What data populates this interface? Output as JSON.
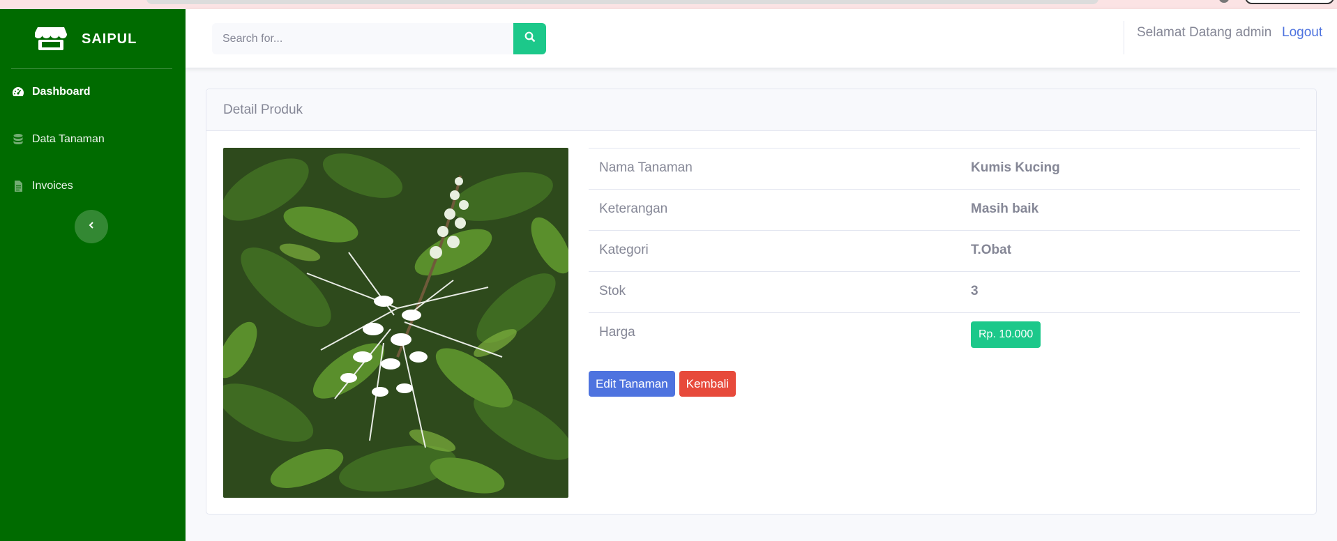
{
  "brand": {
    "name": "SAIPUL",
    "icon": "store-icon"
  },
  "sidebar": {
    "items": [
      {
        "label": "Dashboard",
        "icon": "tachometer-icon",
        "active": true
      },
      {
        "label": "Data Tanaman",
        "icon": "database-icon",
        "active": false
      },
      {
        "label": "Invoices",
        "icon": "file-icon",
        "active": false
      }
    ],
    "toggle_icon": "chevron-left-icon"
  },
  "topbar": {
    "search_placeholder": "Search for...",
    "search_icon": "search-icon",
    "welcome_text": "Selamat Datang admin",
    "logout_label": "Logout"
  },
  "card": {
    "title": "Detail Produk",
    "image_alt": "Kumis Kucing plant with white flowers",
    "details": [
      {
        "label": "Nama Tanaman",
        "value": "Kumis Kucing"
      },
      {
        "label": "Keterangan",
        "value": "Masih baik"
      },
      {
        "label": "Kategori",
        "value": "T.Obat"
      },
      {
        "label": "Stok",
        "value": "3"
      }
    ],
    "price": {
      "label": "Harga",
      "value": "Rp. 10.000"
    },
    "edit_label": "Edit Tanaman",
    "back_label": "Kembali"
  },
  "colors": {
    "sidebar": "#006b00",
    "accent_green": "#1cc88a",
    "primary": "#4e73df",
    "danger": "#e74a3b",
    "text_muted": "#858796"
  }
}
